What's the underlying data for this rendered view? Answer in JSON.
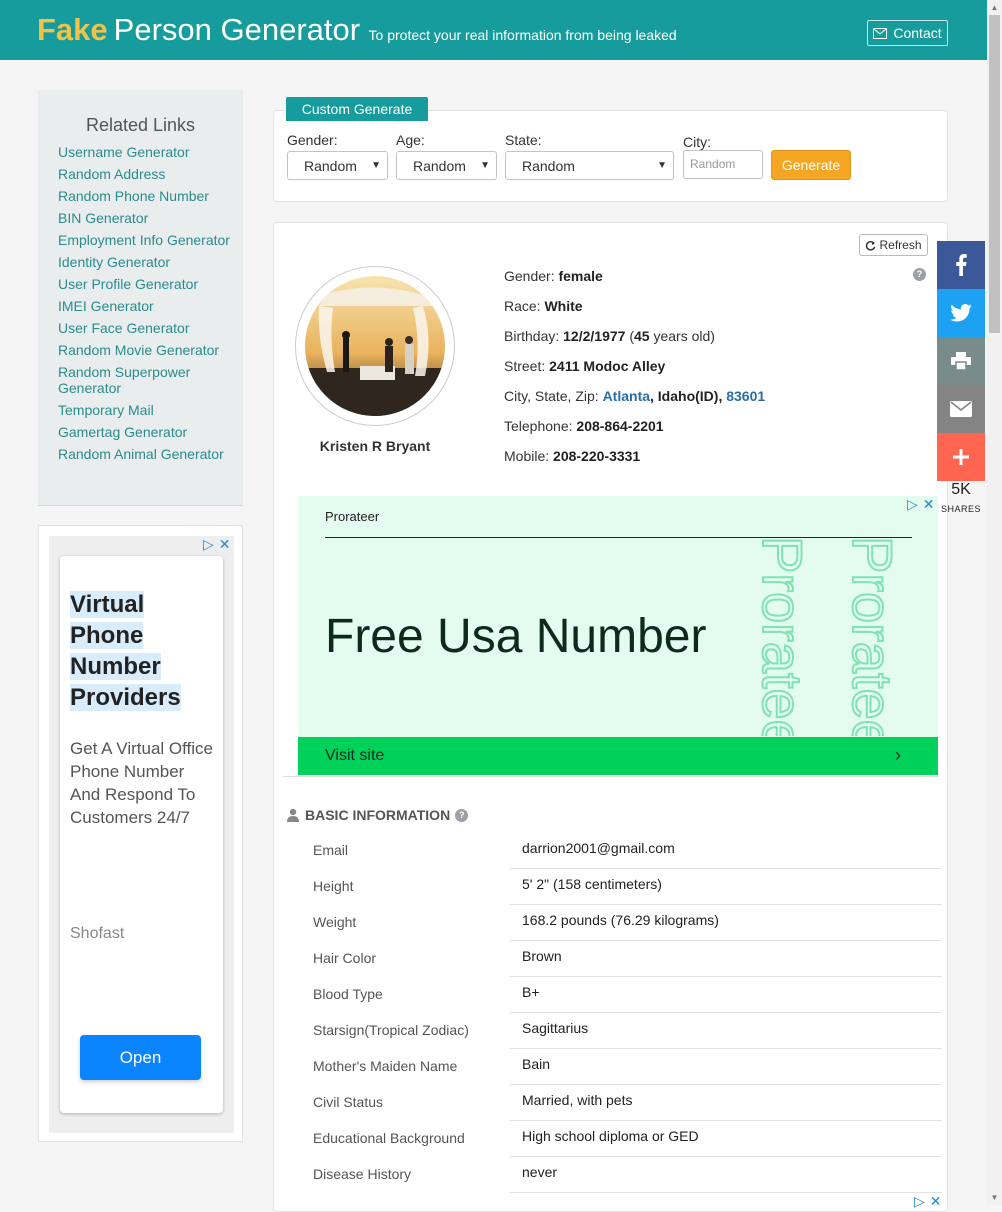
{
  "header": {
    "brand_fake": "Fake",
    "brand_rest": "Person Generator",
    "tagline": "To protect your real information from being leaked",
    "contact_label": "Contact",
    "bg_color": "#169c9c"
  },
  "related": {
    "title": "Related Links",
    "links": [
      "Username Generator",
      "Random Address",
      "Random Phone Number",
      "BIN Generator",
      "Employment Info Generator",
      "Identity Generator",
      "User Profile Generator",
      "IMEI Generator",
      "User Face Generator",
      "Random Movie Generator",
      "Random Superpower Generator",
      "Temporary Mail",
      "Gamertag Generator",
      "Random Animal Generator"
    ]
  },
  "ad_left": {
    "headline": [
      "Virtual",
      "Phone",
      "Number",
      "Providers"
    ],
    "description": "Get A Virtual Office Phone Number And Respond To Customers 24/7",
    "advertiser": "Shofast",
    "cta": "Open"
  },
  "form": {
    "tab_label": "Custom Generate",
    "gender_label": "Gender:",
    "gender_value": "Random",
    "age_label": "Age:",
    "age_value": "Random",
    "state_label": "State:",
    "state_value": "Random",
    "city_label": "City:",
    "city_placeholder": "Random",
    "generate_label": "Generate"
  },
  "profile": {
    "refresh_label": "Refresh",
    "name": "Kristen R Bryant",
    "gender_label": "Gender:",
    "gender": "female",
    "race_label": "Race:",
    "race": "White",
    "birthday_label": "Birthday:",
    "birthday": "12/2/1977",
    "age": "45",
    "age_suffix": "years old)",
    "street_label": "Street:",
    "street": "2411 Modoc Alley",
    "csz_label": "City, State, Zip:",
    "city": "Atlanta",
    "state": "Idaho(ID),",
    "zip": "83601",
    "telephone_label": "Telephone:",
    "telephone": "208-864-2201",
    "mobile_label": "Mobile:",
    "mobile": "208-220-3331"
  },
  "ad_mid": {
    "advertiser": "Prorateer",
    "headline": "Free Usa Number",
    "cta": "Visit site"
  },
  "basic_info": {
    "title": "BASIC INFORMATION",
    "rows": [
      {
        "k": "Email",
        "v": "darrion2001@gmail.com"
      },
      {
        "k": "Height",
        "v": "5' 2\" (158 centimeters)"
      },
      {
        "k": "Weight",
        "v": "168.2 pounds (76.29 kilograms)"
      },
      {
        "k": "Hair Color",
        "v": "Brown"
      },
      {
        "k": "Blood Type",
        "v": "B+"
      },
      {
        "k": "Starsign(Tropical Zodiac)",
        "v": "Sagittarius"
      },
      {
        "k": "Mother's Maiden Name",
        "v": "Bain"
      },
      {
        "k": "Civil Status",
        "v": "Married, with pets"
      },
      {
        "k": "Educational Background",
        "v": "High school diploma or GED"
      },
      {
        "k": "Disease History",
        "v": "never"
      }
    ]
  },
  "share": {
    "count": "5K",
    "label": "SHARES",
    "buttons": [
      "facebook-icon",
      "twitter-icon",
      "print-icon",
      "email-icon",
      "plus-icon"
    ],
    "colors": [
      "#3b5998",
      "#1da1f2",
      "#7a8b8b",
      "#848484",
      "#ff6550"
    ]
  }
}
